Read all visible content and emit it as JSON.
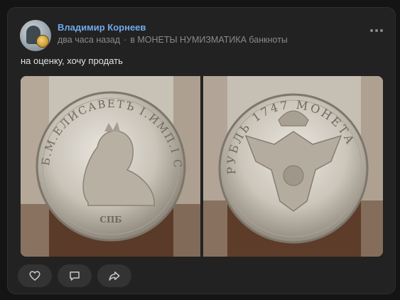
{
  "post": {
    "author": "Владимир Корнеев",
    "time": "два часа назад",
    "separator": "·",
    "community": "в МОНЕТЫ НУМИЗМАТИКА банкноты",
    "text": "на оценку, хочу продать"
  },
  "coin": {
    "obverse_legend": "Б.М.ЕЛИСАВЕТЪ І.ИМП.І САМОД.ВСЕРОС",
    "obverse_mint": "СПБ",
    "reverse_legend": "РУБЛЬ 1747 МОНЕТА"
  },
  "colors": {
    "link": "#71aaeb",
    "card": "#222222",
    "action_bg": "#333333"
  },
  "icons": {
    "like": "heart-icon",
    "comment": "comment-icon",
    "share": "share-icon",
    "more": "more-dots-icon"
  }
}
